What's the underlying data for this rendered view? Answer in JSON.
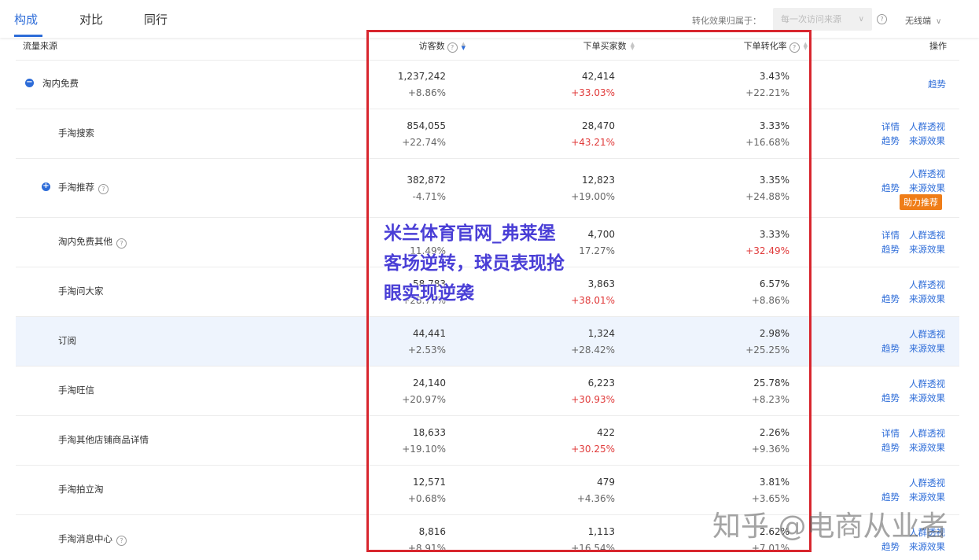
{
  "tabs": [
    "构成",
    "对比",
    "同行"
  ],
  "filter": {
    "label": "转化效果归属于：",
    "select_value": "每一次访问来源",
    "device": "无线端"
  },
  "table": {
    "headers": {
      "source": "流量来源",
      "visitors": "访客数",
      "buyers": "下单买家数",
      "rate": "下单转化率",
      "action": "操作"
    },
    "rows": [
      {
        "name": "淘内免费",
        "visitors": "1,237,242",
        "visitors_chg": "+8.86%",
        "buyers": "42,414",
        "buyers_chg": "+33.03%",
        "rate": "3.43%",
        "rate_chg": "+22.21%",
        "ops": [
          "趋势"
        ]
      },
      {
        "name": "手淘搜索",
        "visitors": "854,055",
        "visitors_chg": "+22.74%",
        "buyers": "28,470",
        "buyers_chg": "+43.21%",
        "rate": "3.33%",
        "rate_chg": "+16.68%",
        "ops": [
          "详情",
          "人群透视",
          "趋势",
          "来源效果"
        ]
      },
      {
        "name": "手淘推荐",
        "visitors": "382,872",
        "visitors_chg": "-4.71%",
        "buyers": "12,823",
        "buyers_chg": "+19.00%",
        "rate": "3.35%",
        "rate_chg": "+24.88%",
        "ops": [
          "人群透视",
          "趋势",
          "来源效果"
        ],
        "badge": "助力推荐"
      },
      {
        "name": "淘内免费其他",
        "visitors_chg": "11.49%",
        "buyers": "4,700",
        "buyers_chg": "17.27%",
        "rate": "3.33%",
        "rate_chg": "+32.49%",
        "ops": [
          "详情",
          "人群透视",
          "趋势",
          "来源效果"
        ]
      },
      {
        "name": "手淘问大家",
        "visitors": "58,783",
        "visitors_chg": "+28.77%",
        "buyers": "3,863",
        "buyers_chg": "+38.01%",
        "rate": "6.57%",
        "rate_chg": "+8.86%",
        "ops": [
          "人群透视",
          "趋势",
          "来源效果"
        ]
      },
      {
        "name": "订阅",
        "visitors": "44,441",
        "visitors_chg": "+2.53%",
        "buyers": "1,324",
        "buyers_chg": "+28.42%",
        "rate": "2.98%",
        "rate_chg": "+25.25%",
        "ops": [
          "人群透视",
          "趋势",
          "来源效果"
        ]
      },
      {
        "name": "手淘旺信",
        "visitors": "24,140",
        "visitors_chg": "+20.97%",
        "buyers": "6,223",
        "buyers_chg": "+30.93%",
        "rate": "25.78%",
        "rate_chg": "+8.23%",
        "ops": [
          "人群透视",
          "趋势",
          "来源效果"
        ]
      },
      {
        "name": "手淘其他店铺商品详情",
        "visitors": "18,633",
        "visitors_chg": "+19.10%",
        "buyers": "422",
        "buyers_chg": "+30.25%",
        "rate": "2.26%",
        "rate_chg": "+9.36%",
        "ops": [
          "详情",
          "人群透视",
          "趋势",
          "来源效果"
        ]
      },
      {
        "name": "手淘拍立淘",
        "visitors": "12,571",
        "visitors_chg": "+0.68%",
        "buyers": "479",
        "buyers_chg": "+4.36%",
        "rate": "3.81%",
        "rate_chg": "+3.65%",
        "ops": [
          "人群透视",
          "趋势",
          "来源效果"
        ]
      },
      {
        "name": "手淘消息中心",
        "visitors": "8,816",
        "visitors_chg": "+8.91%",
        "buyers": "1,113",
        "buyers_chg": "+16.54%",
        "rate": "2.62%",
        "rate_chg": "+7.01%",
        "ops": [
          "人群透视",
          "趋势",
          "来源效果"
        ]
      }
    ]
  },
  "overlay_text": [
    "米兰体育官网_弗莱堡",
    "客场逆转，球员表现抢",
    "眼实现逆袭"
  ],
  "watermark": "知乎 @电商从业者",
  "colors": {
    "accent": "#2d6cd8",
    "negative": "#e03a3a",
    "highlight_border": "#d8262e",
    "badge": "#ef7d18",
    "overlay": "#4a3fd6"
  }
}
